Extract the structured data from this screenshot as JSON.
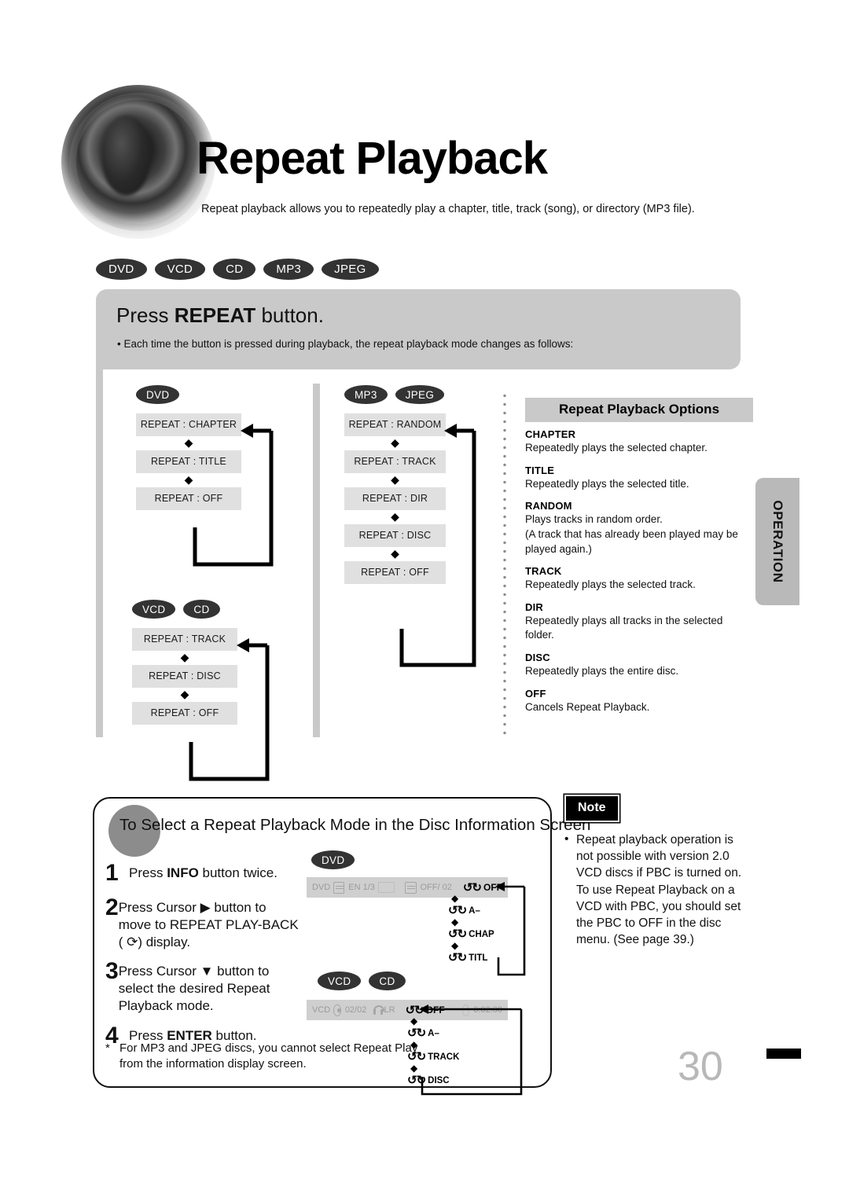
{
  "header": {
    "title": "Repeat Playback",
    "subtitle": "Repeat playback allows you to repeatedly play a chapter, title, track (song), or directory (MP3 file).",
    "speaker_icon": "speaker-graphic"
  },
  "disc_badges": [
    "DVD",
    "VCD",
    "CD",
    "MP3",
    "JPEG"
  ],
  "instruction": {
    "title_prefix": "Press ",
    "title_bold": "REPEAT",
    "title_suffix": " button.",
    "bullet": "• Each time the button is pressed during playback, the repeat playback mode changes as follows:"
  },
  "flows": [
    {
      "id": "dvd",
      "badges": [
        "DVD"
      ],
      "steps": [
        "REPEAT : CHAPTER",
        "REPEAT : TITLE",
        "REPEAT : OFF"
      ]
    },
    {
      "id": "vcd-cd",
      "badges": [
        "VCD",
        "CD"
      ],
      "steps": [
        "REPEAT : TRACK",
        "REPEAT : DISC",
        "REPEAT : OFF"
      ]
    },
    {
      "id": "mp3-jpeg",
      "badges": [
        "MP3",
        "JPEG"
      ],
      "steps": [
        "REPEAT : RANDOM",
        "REPEAT : TRACK",
        "REPEAT : DIR",
        "REPEAT : DISC",
        "REPEAT : OFF"
      ]
    }
  ],
  "options": {
    "title": "Repeat Playback Options",
    "items": [
      {
        "term": "CHAPTER",
        "desc": "Repeatedly plays the selected chapter."
      },
      {
        "term": "TITLE",
        "desc": "Repeatedly plays the selected title."
      },
      {
        "term": "RANDOM",
        "desc": "Plays tracks in random order.\n(A track that has already been played may be played again.)"
      },
      {
        "term": "TRACK",
        "desc": "Repeatedly plays the selected track."
      },
      {
        "term": "DIR",
        "desc": "Repeatedly plays all tracks in the selected folder."
      },
      {
        "term": "DISC",
        "desc": "Repeatedly plays the entire disc."
      },
      {
        "term": "OFF",
        "desc": "Cancels Repeat Playback."
      }
    ]
  },
  "side_tab": {
    "label": "OPERATION"
  },
  "info_box": {
    "heading": "To Select a Repeat Playback Mode in the Disc Information Screen",
    "steps": [
      {
        "num": "1",
        "html_prefix": "Press ",
        "bold": "INFO",
        "suffix": " button twice."
      },
      {
        "num": "2",
        "text": "Press Cursor ▶ button to move to REPEAT PLAY-BACK ( ⟳) display."
      },
      {
        "num": "3",
        "text": "Press Cursor ▼ button to select the desired Repeat Playback mode."
      },
      {
        "num": "4",
        "html_prefix": "Press ",
        "bold": "ENTER",
        "suffix": " button."
      }
    ],
    "footnote": "For MP3 and JPEG discs, you cannot select Repeat Play from the information display screen.",
    "footnote_marker": "*",
    "dvd_osd": {
      "badges": [
        "DVD"
      ],
      "bar_fields": [
        "DVD",
        "EN 1/3",
        "OFF/  02",
        "OFF"
      ],
      "modes": [
        "A–",
        "CHAP",
        "TITL"
      ]
    },
    "vcd_osd": {
      "badges": [
        "VCD",
        "CD"
      ],
      "bar_fields": [
        "VCD",
        "02/02",
        "LR",
        "OFF",
        "0:02:00"
      ],
      "modes": [
        "A–",
        "TRACK",
        "DISC"
      ]
    }
  },
  "note": {
    "label": "Note",
    "bullet": "•",
    "text": "Repeat playback operation is not possible with version 2.0 VCD discs if PBC is turned on. To use Repeat Playback on a VCD with PBC, you should set the PBC to OFF in the disc menu. (See page 39.)"
  },
  "page_number": "30",
  "colors": {
    "badge_bg": "#333333",
    "panel_gray": "#c9c9c9",
    "box_gray": "#e0e0e0",
    "tab_gray": "#b9b9b9"
  }
}
